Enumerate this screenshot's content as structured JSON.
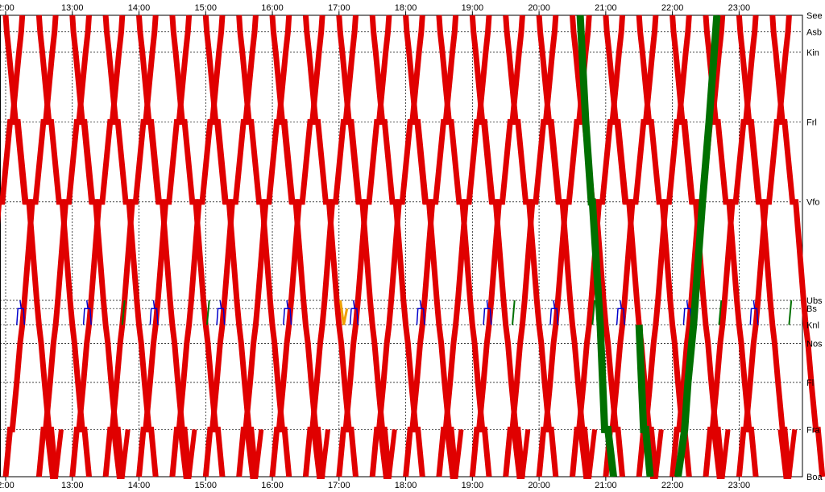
{
  "chart_data": {
    "type": "line",
    "title": "",
    "xlabel": "",
    "ylabel": "",
    "x_ticks": [
      "2:00",
      "13:00",
      "14:00",
      "15:00",
      "16:00",
      "17:00",
      "18:00",
      "19:00",
      "20:00",
      "21:00",
      "22:00",
      "23:00"
    ],
    "x_ticks_bottom": [
      "2:00",
      "13:00",
      "14:00",
      "15:00",
      "16:00",
      "17:00",
      "18:00",
      "19:00",
      "20:00",
      "21:00",
      "22:00",
      "23:00"
    ],
    "x_hours": [
      12,
      13,
      14,
      15,
      16,
      17,
      18,
      19,
      20,
      21,
      22,
      23
    ],
    "xlim_hours": [
      12.0,
      23.95
    ],
    "stations": [
      {
        "name": "See",
        "pos": 0.0
      },
      {
        "name": "Asb",
        "pos": 0.8
      },
      {
        "name": "Kin",
        "pos": 1.8
      },
      {
        "name": "Frl",
        "pos": 5.2
      },
      {
        "name": "Vfo",
        "pos": 9.1
      },
      {
        "name": "Ubs",
        "pos": 13.9
      },
      {
        "name": "Bs",
        "pos": 14.3
      },
      {
        "name": "Knl",
        "pos": 15.1
      },
      {
        "name": "Nos",
        "pos": 16.0
      },
      {
        "name": "Fl",
        "pos": 17.9
      },
      {
        "name": "Fra",
        "pos": 20.2
      },
      {
        "name": "Boa",
        "pos": 22.5
      }
    ],
    "grid": true,
    "colors": {
      "regular": "#e00000",
      "special": "#007000",
      "freight": "#0000cc",
      "other": "#f0a000"
    },
    "series": [
      {
        "category": "regular",
        "color": "#e00000",
        "offsets_min": [
          0,
          7,
          15,
          22,
          30,
          37,
          45,
          52
        ],
        "hours": [
          12,
          13,
          14,
          15,
          16,
          17,
          18,
          19,
          20,
          21,
          22,
          23
        ]
      },
      {
        "category": "special",
        "color": "#007000",
        "runs": [
          {
            "start": "20:37",
            "end": "21:52",
            "direction": "down"
          },
          {
            "start": "22:45",
            "end": "23:05",
            "direction": "up"
          },
          {
            "start": "21:30",
            "end": "22:10",
            "direction": "down"
          }
        ]
      },
      {
        "category": "freight",
        "color": "#0000cc",
        "note_hours": [
          12,
          13,
          14,
          15,
          16,
          17,
          18,
          19,
          20,
          21,
          22,
          23
        ]
      },
      {
        "category": "other",
        "color": "#f0a000",
        "runs": [
          {
            "start": "17:00",
            "end": "17:10"
          }
        ]
      }
    ]
  }
}
